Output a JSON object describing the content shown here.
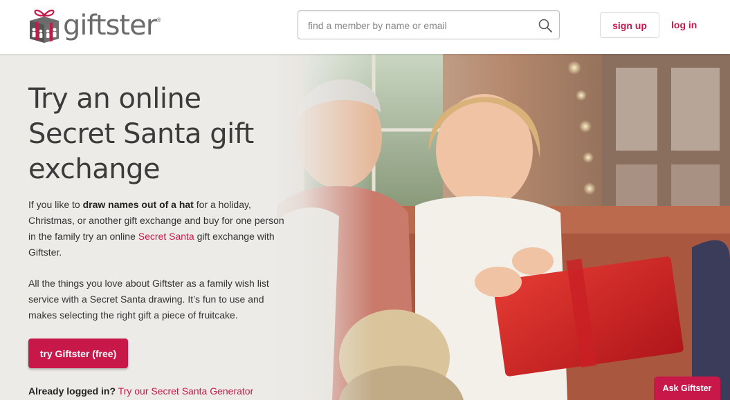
{
  "header": {
    "logo_text": "giftster",
    "logo_reg": "®",
    "search_placeholder": "find a member by name or email",
    "signup_label": "sign up",
    "login_label": "log in"
  },
  "hero": {
    "headline": "Try an online Secret Santa gift exchange",
    "para1": {
      "t1": "If you like to ",
      "bold": "draw names out of a hat",
      "t2": " for a holiday, Christmas, or another gift exchange and buy for one person in the family try an online ",
      "link": "Secret Santa",
      "t3": " gift exchange with Giftster."
    },
    "para2": "All the things you love about Giftster as a family wish list service with a Secret Santa drawing. It’s fun to use and makes selecting the right gift a piece of fruitcake.",
    "cta_label": "try Giftster (free)",
    "already_bold": "Already logged in?",
    "already_link": "Try our Secret Santa Generator"
  },
  "ask_label": "Ask Giftster",
  "colors": {
    "brand": "#c8184a",
    "text": "#333333",
    "hero_bg": "#ecebe8"
  },
  "icons": {
    "logo": "gift-box-logo-icon",
    "search": "search-icon"
  }
}
